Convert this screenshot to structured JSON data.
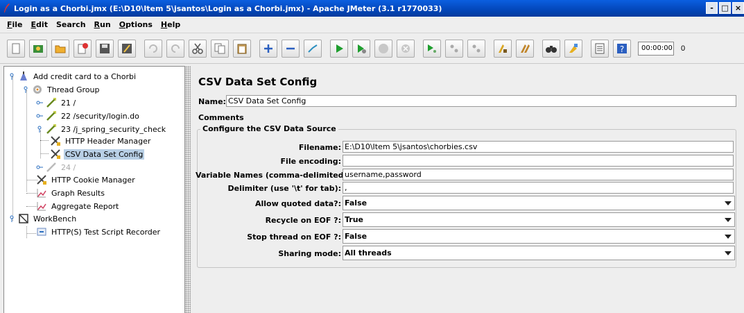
{
  "window": {
    "title": "Login as a Chorbi.jmx (E:\\D10\\Item 5\\jsantos\\Login as a Chorbi.jmx) - Apache JMeter (3.1 r1770033)",
    "buttons": [
      "-",
      "□",
      "×"
    ]
  },
  "menu": {
    "items": [
      {
        "label": "File",
        "mnemonic": "F",
        "rest": "ile"
      },
      {
        "label": "Edit",
        "mnemonic": "E",
        "rest": "dit"
      },
      {
        "label": "Search",
        "mnemonic": "",
        "rest": "Search"
      },
      {
        "label": "Run",
        "mnemonic": "R",
        "rest": "un"
      },
      {
        "label": "Options",
        "mnemonic": "O",
        "rest": "ptions"
      },
      {
        "label": "Help",
        "mnemonic": "H",
        "rest": "elp"
      }
    ]
  },
  "toolbar": {
    "icons": [
      "new-icon",
      "templates-icon",
      "open-icon",
      "close-icon",
      "save-icon",
      "save-as-icon",
      "undo-icon",
      "redo-icon",
      "cut-icon",
      "copy-icon",
      "paste-icon",
      "expand-icon",
      "collapse-icon",
      "toggle-icon",
      "start-icon",
      "start-no-pause-icon",
      "stop-icon",
      "shutdown-icon",
      "remote-start-icon",
      "remote-stop-icon",
      "remote-shutdown-icon",
      "clear-icon",
      "clear-all-icon",
      "search-icon",
      "reset-search-icon",
      "function-helper-icon",
      "help-icon"
    ],
    "timer": "00:00:00",
    "timer_trail": "0"
  },
  "tree": {
    "nodes": [
      {
        "label": "Add credit card to a Chorbi",
        "icon": "test-plan-icon"
      },
      {
        "label": "Thread Group",
        "icon": "thread-group-icon"
      },
      {
        "label": "21 /",
        "icon": "sampler-icon"
      },
      {
        "label": "22 /security/login.do",
        "icon": "sampler-icon"
      },
      {
        "label": "23 /j_spring_security_check",
        "icon": "sampler-icon"
      },
      {
        "label": "HTTP Header Manager",
        "icon": "config-icon"
      },
      {
        "label": "CSV Data Set Config",
        "icon": "config-icon"
      },
      {
        "label": "24 /",
        "icon": "sampler-icon"
      },
      {
        "label": "HTTP Cookie Manager",
        "icon": "config-icon"
      },
      {
        "label": "Graph Results",
        "icon": "listener-icon"
      },
      {
        "label": "Aggregate Report",
        "icon": "listener-icon"
      },
      {
        "label": "WorkBench",
        "icon": "workbench-icon"
      },
      {
        "label": "HTTP(S) Test Script Recorder",
        "icon": "recorder-icon"
      }
    ]
  },
  "panel": {
    "title": "CSV Data Set Config",
    "name_label": "Name:",
    "name_value": "CSV Data Set Config",
    "comments_label": "Comments:",
    "group_title": "Configure the CSV Data Source",
    "filename_label": "Filename:",
    "filename_value": "E:\\D10\\Item 5\\jsantos\\chorbies.csv",
    "encoding_label": "File encoding:",
    "encoding_value": "",
    "varnames_label": "Variable Names (comma-delimited):",
    "varnames_value": "username,password",
    "delimiter_label": "Delimiter (use '\\t' for tab):",
    "delimiter_value": ",",
    "quoted_label": "Allow quoted data?:",
    "quoted_value": "False",
    "recycle_label": "Recycle on EOF ?:",
    "recycle_value": "True",
    "stop_label": "Stop thread on EOF ?:",
    "stop_value": "False",
    "sharing_label": "Sharing mode:",
    "sharing_value": "All threads"
  }
}
